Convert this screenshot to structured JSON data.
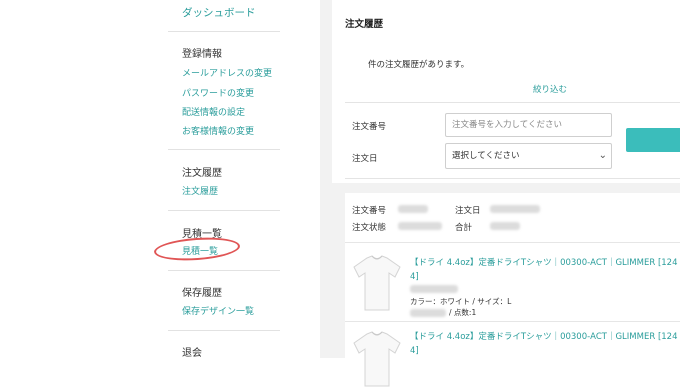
{
  "sidebar": {
    "dashboard": "ダッシュボード",
    "registration_heading": "登録情報",
    "registration_links": [
      "メールアドレスの変更",
      "パスワードの変更",
      "配送情報の設定",
      "お客様情報の変更"
    ],
    "order_history_heading": "注文履歴",
    "order_history_link": "注文履歴",
    "estimate_heading": "見積一覧",
    "estimate_link": "見積一覧",
    "saved_heading": "保存履歴",
    "saved_link": "保存デザイン一覧",
    "withdraw_heading": "退会"
  },
  "main": {
    "title": "注文履歴",
    "count_text": "件の注文履歴があります。",
    "filter_link": "絞り込む",
    "form": {
      "order_number_label": "注文番号",
      "order_number_placeholder": "注文番号を入力してください",
      "order_date_label": "注文日",
      "order_date_value": "選択してください"
    },
    "order": {
      "number_label": "注文番号",
      "date_label": "注文日",
      "status_label": "注文状態",
      "total_label": "合計"
    },
    "items": [
      {
        "title": "【ドライ 4.4oz】定番ドライTシャツ｜00300-ACT｜GLIMMER [124 4]",
        "attributes": "カラー：ホワイト / サイズ：L",
        "quantity": "/ 点数:1"
      },
      {
        "title": "【ドライ 4.4oz】定番ドライTシャツ｜00300-ACT｜GLIMMER [124 4]"
      }
    ]
  },
  "colors": {
    "accent": "#2a9d9b",
    "button": "#3bbdbb",
    "highlight_circle": "#e05555",
    "background": "#f2f2f2"
  }
}
